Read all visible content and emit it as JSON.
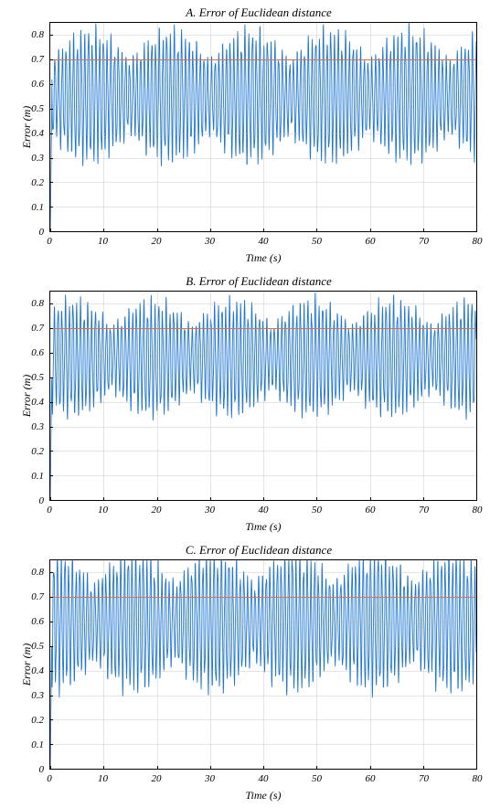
{
  "charts": [
    {
      "title": "A. Error of Euclidean distance",
      "xlabel": "Time (s)",
      "ylabel": "Error (m)"
    },
    {
      "title": "B. Error of Euclidean distance",
      "xlabel": "Time (s)",
      "ylabel": "Error (m)"
    },
    {
      "title": "C. Error of Euclidean distance",
      "xlabel": "Time (s)",
      "ylabel": "Error (m)"
    }
  ],
  "y_ticks": [
    "0",
    "0.1",
    "0.2",
    "0.3",
    "0.4",
    "0.5",
    "0.6",
    "0.7",
    "0.8"
  ],
  "x_ticks": [
    "0",
    "10",
    "20",
    "30",
    "40",
    "50",
    "60",
    "70",
    "80"
  ],
  "chart_data": [
    {
      "type": "line",
      "title": "A. Error of Euclidean distance",
      "xlabel": "Time (s)",
      "ylabel": "Error (m)",
      "xlim": [
        0,
        80
      ],
      "ylim": [
        0,
        0.85
      ],
      "reference_line": 0.7,
      "x_ticks": [
        0,
        10,
        20,
        30,
        40,
        50,
        60,
        70,
        80
      ],
      "y_ticks": [
        0,
        0.1,
        0.2,
        0.3,
        0.4,
        0.5,
        0.6,
        0.7,
        0.8
      ],
      "series": [
        {
          "name": "error",
          "description": "Dense high-frequency oscillatory error signal with slowly varying envelope. Starts near 0 at t=0, jumps up and oscillates around 0.55 mean with peaks up to ~0.85 and troughs down to ~0.30. Envelope peaks roughly every ~15s.",
          "approximate_summary": {
            "mean": 0.55,
            "min": 0.28,
            "max": 0.85,
            "dominant_fast_period_s": 0.7,
            "envelope_period_s": 15
          }
        },
        {
          "name": "reference",
          "x": [
            0,
            80
          ],
          "y": [
            0.7,
            0.7
          ]
        }
      ]
    },
    {
      "type": "line",
      "title": "B. Error of Euclidean distance",
      "xlabel": "Time (s)",
      "ylabel": "Error (m)",
      "xlim": [
        0,
        80
      ],
      "ylim": [
        0,
        0.85
      ],
      "reference_line": 0.7,
      "x_ticks": [
        0,
        10,
        20,
        30,
        40,
        50,
        60,
        70,
        80
      ],
      "y_ticks": [
        0,
        0.1,
        0.2,
        0.3,
        0.4,
        0.5,
        0.6,
        0.7,
        0.8
      ],
      "series": [
        {
          "name": "error",
          "description": "High-frequency oscillatory error. Starts near 0 then rises to oscillate about 0.58 with peaks ~0.84 and troughs ~0.35. Envelope modulated similarly to A.",
          "approximate_summary": {
            "mean": 0.58,
            "min": 0.34,
            "max": 0.84,
            "dominant_fast_period_s": 0.7,
            "envelope_period_s": 15
          }
        },
        {
          "name": "reference",
          "x": [
            0,
            80
          ],
          "y": [
            0.7,
            0.7
          ]
        }
      ]
    },
    {
      "type": "line",
      "title": "C. Error of Euclidean distance",
      "xlabel": "Time (s)",
      "ylabel": "Error (m)",
      "xlim": [
        0,
        80
      ],
      "ylim": [
        0,
        0.85
      ],
      "reference_line": 0.7,
      "x_ticks": [
        0,
        10,
        20,
        30,
        40,
        50,
        60,
        70,
        80
      ],
      "y_ticks": [
        0,
        0.1,
        0.2,
        0.3,
        0.4,
        0.5,
        0.6,
        0.7,
        0.8
      ],
      "series": [
        {
          "name": "error",
          "description": "High-frequency oscillatory error with larger amplitude than A/B. Starts near 0, rises, oscillates about ~0.6 with peaks ~0.88 and troughs ~0.28.",
          "approximate_summary": {
            "mean": 0.6,
            "min": 0.28,
            "max": 0.88,
            "dominant_fast_period_s": 0.7,
            "envelope_period_s": 15
          }
        },
        {
          "name": "reference",
          "x": [
            0,
            80
          ],
          "y": [
            0.7,
            0.7
          ]
        }
      ]
    }
  ]
}
